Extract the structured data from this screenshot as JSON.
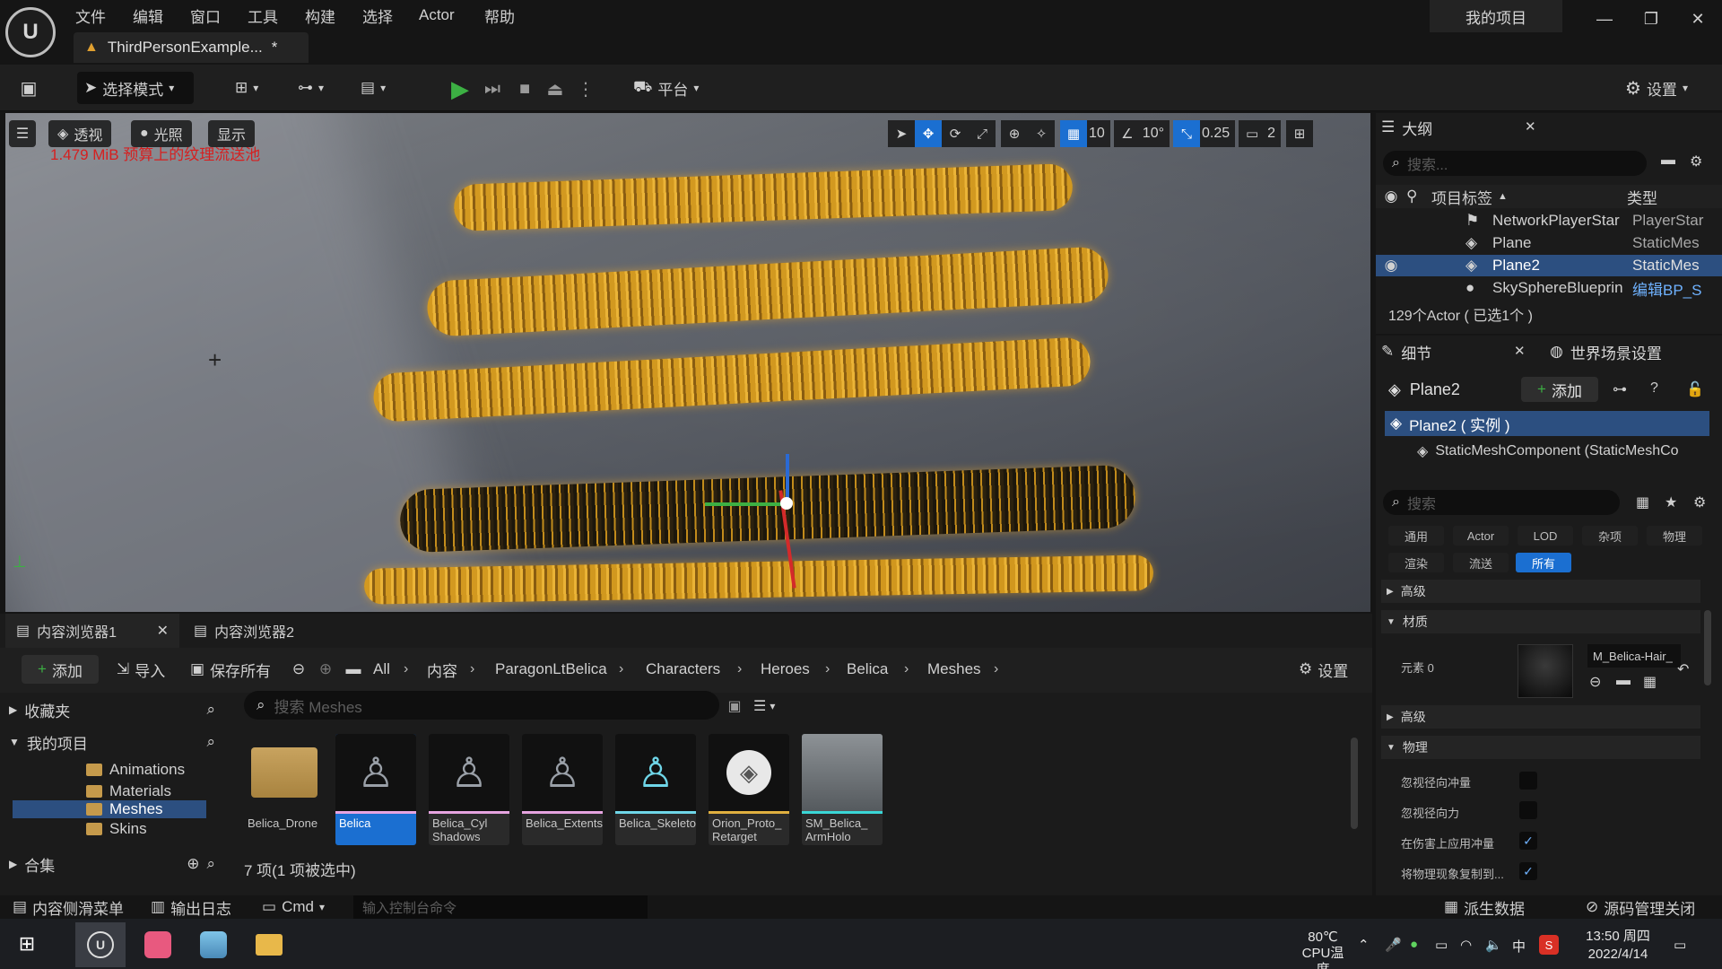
{
  "menu": [
    "文件",
    "编辑",
    "窗口",
    "工具",
    "构建",
    "选择",
    "Actor",
    "帮助"
  ],
  "document_tab": "ThirdPersonExample...",
  "document_tab_modified": "*",
  "project_name": "我的项目",
  "toolbar": {
    "mode_label": "选择模式",
    "platform_label": "平台",
    "settings_label": "设置"
  },
  "viewport": {
    "perspective_label": "透视",
    "lighting_label": "光照",
    "show_label": "显示",
    "warning_text": "1.479 MiB 预算上的纹理流送池",
    "grid_snap": "10",
    "rotation_snap": "10°",
    "scale_snap": "0.25",
    "camera_speed": "2"
  },
  "content_browser": {
    "tab1": "内容浏览器1",
    "tab2": "内容浏览器2",
    "add_label": "添加",
    "import_label": "导入",
    "save_all_label": "保存所有",
    "settings_label": "设置",
    "breadcrumbs": [
      "All",
      "内容",
      "ParagonLtBelica",
      "Characters",
      "Heroes",
      "Belica",
      "Meshes"
    ],
    "favorites_label": "收藏夹",
    "project_label": "我的项目",
    "collections_label": "合集",
    "tree_items": [
      "Animations",
      "Materials",
      "Meshes",
      "Skins"
    ],
    "search_placeholder": "搜索 Meshes",
    "assets": [
      {
        "name": "Belica_Drone",
        "bar": "#000000"
      },
      {
        "name": "Belica",
        "bar": "#e6a4e0"
      },
      {
        "name": "Belica_Cyl Shadows",
        "bar": "#e6a4e0"
      },
      {
        "name": "Belica_Extents",
        "bar": "#e6a4e0"
      },
      {
        "name": "Belica_Skeleton",
        "bar": "#6fd6e8"
      },
      {
        "name": "Orion_Proto_ Retarget",
        "bar": "#e0b040"
      },
      {
        "name": "SM_Belica_ ArmHolo",
        "bar": "#3ad6d6"
      }
    ],
    "item_count": "7 项(1 项被选中)"
  },
  "statusbar": {
    "drawer_label": "内容侧滑菜单",
    "output_log_label": "输出日志",
    "cmd_label": "Cmd",
    "cmd_placeholder": "输入控制台命令",
    "derived_data_label": "派生数据",
    "source_control_label": "源码管理关闭"
  },
  "outliner": {
    "title": "大纲",
    "search_placeholder": "搜索...",
    "col_label": "项目标签",
    "col_type": "类型",
    "rows": [
      {
        "label": "NetworkPlayerStar",
        "type": "PlayerStar"
      },
      {
        "label": "Plane",
        "type": "StaticMes"
      },
      {
        "label": "Plane2",
        "type": "StaticMes"
      },
      {
        "label": "SkySphereBlueprin",
        "type": "编辑BP_S"
      }
    ],
    "count_text": "129个Actor ( 已选1个 )"
  },
  "details": {
    "tab_label": "细节",
    "world_settings_label": "世界场景设置",
    "object_name": "Plane2",
    "add_label": "添加",
    "instance_label": "Plane2 ( 实例 )",
    "component_label": "StaticMeshComponent (StaticMeshCo",
    "search_placeholder": "搜索",
    "filter_tabs": [
      "通用",
      "Actor",
      "LOD",
      "杂项",
      "物理",
      "渲染",
      "流送",
      "所有"
    ],
    "active_filter": "所有",
    "section_advanced": "高级",
    "section_material": "材质",
    "element_label": "元素 0",
    "material_name": "M_Belica-Hair_",
    "section_advanced2": "高级",
    "section_physics": "物理",
    "props": [
      {
        "label": "忽视径向冲量",
        "checked": false
      },
      {
        "label": "忽视径向力",
        "checked": false
      },
      {
        "label": "在伤害上应用冲量",
        "checked": true
      },
      {
        "label": "将物理现象复制到...",
        "checked": true
      }
    ]
  },
  "taskbar": {
    "temp": "80℃",
    "temp_label": "CPU温度",
    "ime": "中",
    "time": "13:50 周四",
    "date": "2022/4/14"
  },
  "colors": {
    "accent": "#1b6fd1",
    "play": "#3cb043",
    "warning": "#d62020",
    "stripe": "#f0b429"
  }
}
